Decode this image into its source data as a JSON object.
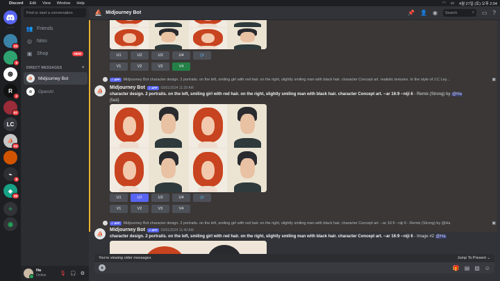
{
  "menubar": {
    "apple": "",
    "app": "Discord",
    "items": [
      "Edit",
      "View",
      "Window",
      "Help"
    ],
    "clock": "4월 27일 (토) 오후 2:04"
  },
  "guilds": [
    {
      "name": "blue",
      "color": "#5865f2",
      "badge": ""
    },
    {
      "name": "server-2",
      "color": "#3b82a8",
      "badge": "24"
    },
    {
      "name": "server-3",
      "color": "#2ea370",
      "badge": "6"
    },
    {
      "name": "openai",
      "color": "#ffffff",
      "badge": ""
    },
    {
      "name": "server-5",
      "color": "#c0392b",
      "badge": "2"
    },
    {
      "name": "server-6",
      "color": "#222222",
      "badge": ""
    },
    {
      "name": "server-7",
      "color": "#9b2c3a",
      "badge": "57"
    },
    {
      "name": "lc",
      "color": "#36393f",
      "badge": "",
      "label": "LC"
    },
    {
      "name": "server-9",
      "color": "#c7c7c7",
      "badge": "24"
    },
    {
      "name": "server-10",
      "color": "#d35400",
      "badge": ""
    },
    {
      "name": "server-11",
      "color": "#2c2f33",
      "badge": "8"
    },
    {
      "name": "server-12",
      "color": "#8e44ad",
      "badge": "26"
    }
  ],
  "channels": {
    "search_placeholder": "Find or start a conversation",
    "nav": [
      {
        "label": "Friends",
        "icon": "👥"
      },
      {
        "label": "Nitro",
        "icon": "◎"
      },
      {
        "label": "Shop",
        "icon": "▣",
        "badge": "NEW"
      }
    ],
    "dm_header": "DIRECT MESSAGES",
    "dms": [
      {
        "label": "Midjourney Bot",
        "active": true,
        "color": "#e8e8e8"
      },
      {
        "label": "OpenAI",
        "active": false,
        "color": "#ffffff"
      }
    ]
  },
  "user": {
    "name": "Ha",
    "status": "Online"
  },
  "header": {
    "title": "Midjourney Bot",
    "search_placeholder": "Search"
  },
  "messages": [
    {
      "buttons_row1": [
        "U1",
        "U2",
        "U3",
        "U4",
        "⟳"
      ],
      "buttons_row2": [
        "V1",
        "V2",
        "V3",
        "V4"
      ],
      "active_v": "V4"
    },
    {
      "reply_text": "Midjourney Bot character design. 2 portraits. on the left, smiling girl with red hair. on the right, slightly smiling man with black hair. character Concept art. realistic textures. In the style of J.C Ley...",
      "author": "Midjourney Bot",
      "app_badge": "✓ APP",
      "time": "03/01/2024 11:39 AM",
      "prompt": "character design. 2 portraits. on the left, smiling girl with red hair. on the right, slightly smiling man with black hair. character Concept art. --ar 16:9 --niji 6",
      "suffix": " - Remix (Strong) by ",
      "mention": "@Ha",
      "suffix2": "(fast)",
      "buttons_row1": [
        "U1",
        "U2",
        "U3",
        "U4",
        "⟳"
      ],
      "buttons_row2": [
        "V1",
        "V2",
        "V3",
        "V4"
      ],
      "active_u": "U2"
    },
    {
      "reply_text": "Midjourney Bot character design. 2 portraits. on the left, smiling girl with red hair. on the right, slightly smiling man with black hair. character Concept art. --ar 16:9 --niji 6 - Remix (Strong) by @Ha",
      "author": "Midjourney Bot",
      "app_badge": "✓ APP",
      "time": "03/01/2024 11:40 AM",
      "prompt": "character design. 2 portraits. on the left, smiling girl with red hair. on the right, slightly smiling man with black hair. character Concept art. --ar 16:9 --niji 6",
      "suffix": " - Image #2 ",
      "mention": "@Ha"
    }
  ],
  "older_bar": {
    "text": "You're viewing older messages",
    "jump": "Jump To Present ⌄"
  }
}
